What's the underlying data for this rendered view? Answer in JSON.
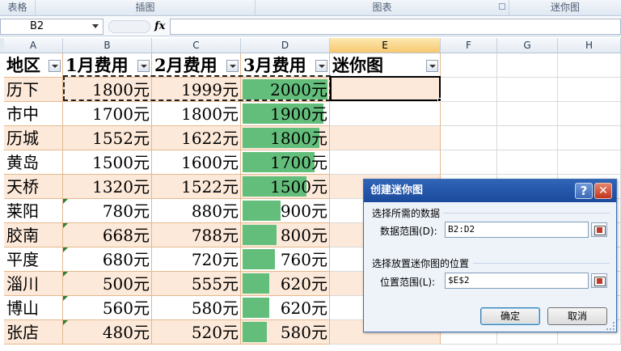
{
  "ribbon": {
    "groups": [
      "表格",
      "插图",
      "图表",
      "迷你图"
    ]
  },
  "formula_bar": {
    "name_box": "B2",
    "fx": "fx",
    "formula": ""
  },
  "columns": [
    "A",
    "B",
    "C",
    "D",
    "E",
    "F",
    "G",
    "H"
  ],
  "table": {
    "headers": [
      "地区",
      "1月费用",
      "2月费用",
      "3月费用",
      "迷你图"
    ],
    "rows": [
      {
        "name": "历下",
        "jan": "1800元",
        "feb": "1999元",
        "mar": "2000元"
      },
      {
        "name": "市中",
        "jan": "1700元",
        "feb": "1800元",
        "mar": "1900元"
      },
      {
        "name": "历城",
        "jan": "1552元",
        "feb": "1622元",
        "mar": "1800元"
      },
      {
        "name": "黄岛",
        "jan": "1500元",
        "feb": "1600元",
        "mar": "1700元"
      },
      {
        "name": "天桥",
        "jan": "1320元",
        "feb": "1522元",
        "mar": "1500元"
      },
      {
        "name": "莱阳",
        "jan": "780元",
        "feb": "880元",
        "mar": "900元"
      },
      {
        "name": "胶南",
        "jan": "668元",
        "feb": "788元",
        "mar": "800元"
      },
      {
        "name": "平度",
        "jan": "680元",
        "feb": "720元",
        "mar": "760元"
      },
      {
        "name": "淄川",
        "jan": "500元",
        "feb": "555元",
        "mar": "620元"
      },
      {
        "name": "博山",
        "jan": "560元",
        "feb": "580元",
        "mar": "620元"
      },
      {
        "name": "张店",
        "jan": "480元",
        "feb": "520元",
        "mar": "580元"
      }
    ],
    "mar_values": [
      2000,
      1900,
      1800,
      1700,
      1500,
      900,
      800,
      760,
      620,
      620,
      580
    ],
    "databar_color": "#63be7b",
    "band_color": "#fde9d9"
  },
  "dialog": {
    "title": "创建迷你图",
    "help_label": "?",
    "close_label": "✕",
    "section_data": "选择所需的数据",
    "data_range_label": "数据范围(D):",
    "data_range_value": "B2:D2",
    "section_location": "选择放置迷你图的位置",
    "location_range_label": "位置范围(L):",
    "location_range_value": "$E$2",
    "ok_label": "确定",
    "cancel_label": "取消"
  }
}
